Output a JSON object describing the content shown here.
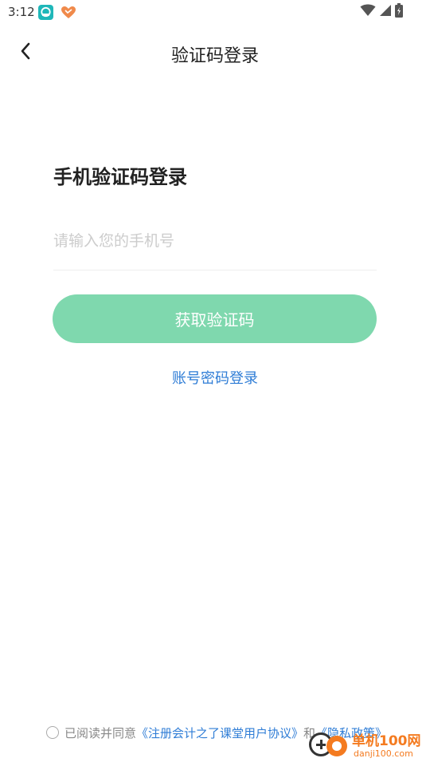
{
  "status_bar": {
    "time": "3:12",
    "icons": [
      "app-notification-icon",
      "heart-app-icon",
      "wifi-icon",
      "signal-icon",
      "battery-icon"
    ]
  },
  "nav": {
    "title": "验证码登录",
    "back_icon": "back-arrow-icon"
  },
  "main": {
    "heading": "手机验证码登录",
    "phone_input": {
      "placeholder": "请输入您的手机号",
      "value": ""
    },
    "get_code_button": "获取验证码",
    "password_login_link": "账号密码登录"
  },
  "agreement": {
    "prefix": "已阅读并同意",
    "terms_link": "《注册会计之了课堂用户协议》",
    "connector": "和",
    "privacy_link": "《隐私政策》"
  },
  "watermark": {
    "title": "单机100网",
    "url": "danji100.com"
  },
  "colors": {
    "primary_button": "#7fd8ae",
    "link": "#2f7dd6",
    "placeholder": "#cccccc",
    "watermark_orange": "#f47b20"
  }
}
